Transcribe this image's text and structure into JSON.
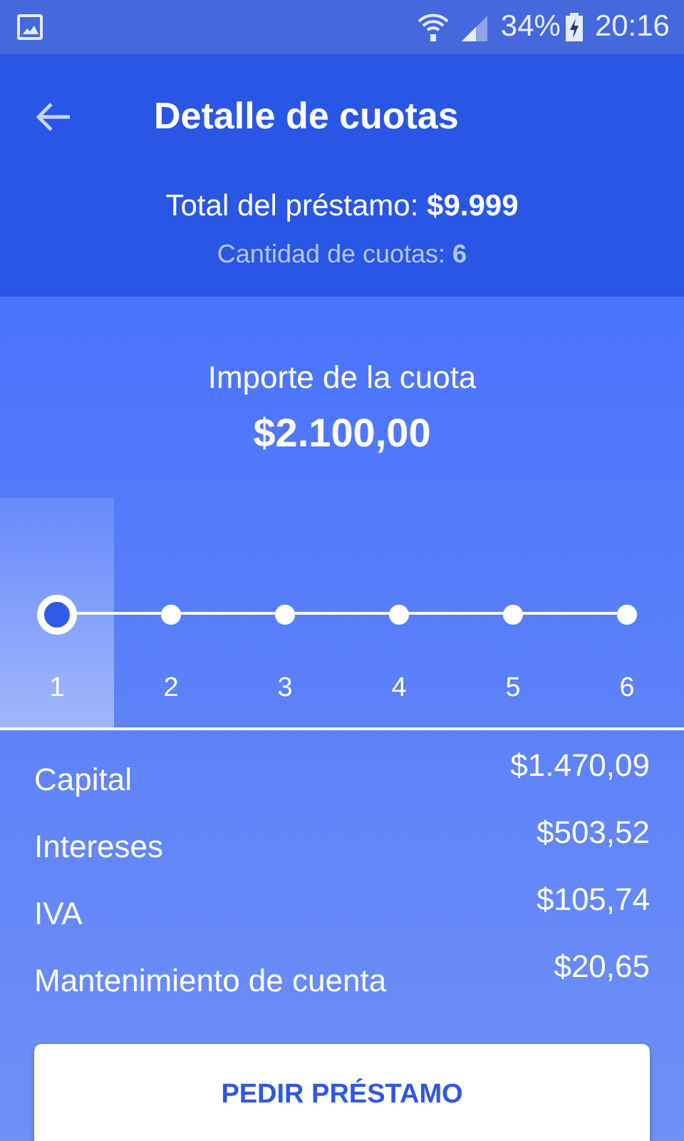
{
  "status_bar": {
    "battery": "34%",
    "time": "20:16"
  },
  "header": {
    "title": "Detalle de cuotas",
    "total": "Total del préstamo: **$9.999**",
    "count": "Cantidad de cuotas: **6**"
  },
  "installment": {
    "label": "Importe de la cuota",
    "amount": "$2.100,00"
  },
  "steps": [
    {
      "label": "1",
      "selected": true
    },
    {
      "label": "2",
      "selected": false
    },
    {
      "label": "3",
      "selected": false
    },
    {
      "label": "4",
      "selected": false
    },
    {
      "label": "5",
      "selected": false
    },
    {
      "label": "6",
      "selected": false
    }
  ],
  "breakdown": [
    {
      "label": "Capital",
      "value": "$1.470,09"
    },
    {
      "label": "Intereses",
      "value": "$503,52"
    },
    {
      "label": "IVA",
      "value": "$105,74"
    },
    {
      "label": "Mantenimiento de cuenta",
      "value": "$20,65"
    }
  ],
  "button": "PEDIR PRÉSTAMO"
}
